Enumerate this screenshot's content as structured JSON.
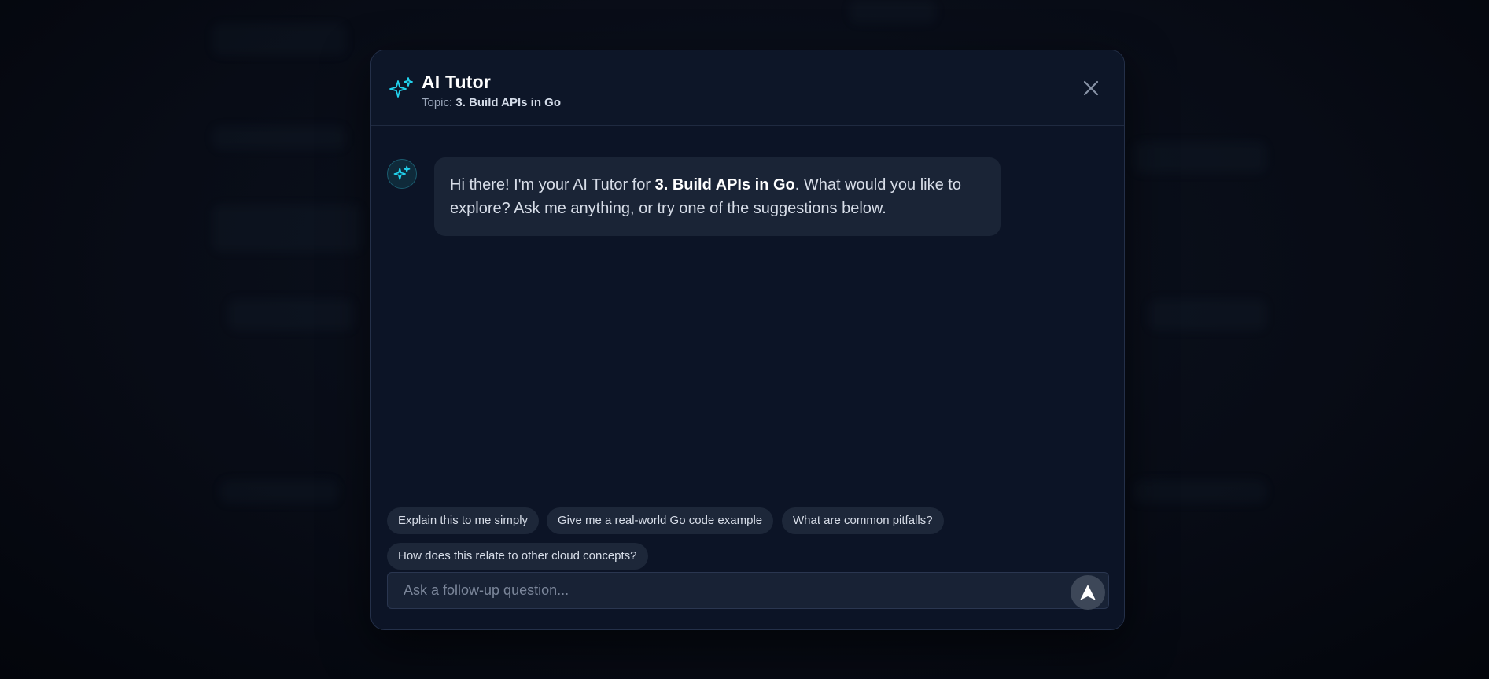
{
  "modal": {
    "title": "AI Tutor",
    "topic_label": "Topic: ",
    "topic_value": "3. Build APIs in Go"
  },
  "message": {
    "prefix": "Hi there! I'm your AI Tutor for ",
    "bold_topic": "3. Build APIs in Go",
    "suffix": ". What would you like to explore? Ask me anything, or try one of the suggestions below."
  },
  "suggestions": [
    "Explain this to me simply",
    "Give me a real-world Go code example",
    "What are common pitfalls?",
    "How does this relate to other cloud concepts?"
  ],
  "input": {
    "placeholder": "Ask a follow-up question...",
    "value": ""
  },
  "icons": {
    "header": "sparkles-icon",
    "avatar": "sparkles-icon",
    "close": "close-icon",
    "send": "send-arrow-icon"
  },
  "colors": {
    "accent": "#22d3ee",
    "modal_bg": "#0c1426",
    "bubble_bg": "#1a2436",
    "chip_bg": "#1d2739"
  }
}
